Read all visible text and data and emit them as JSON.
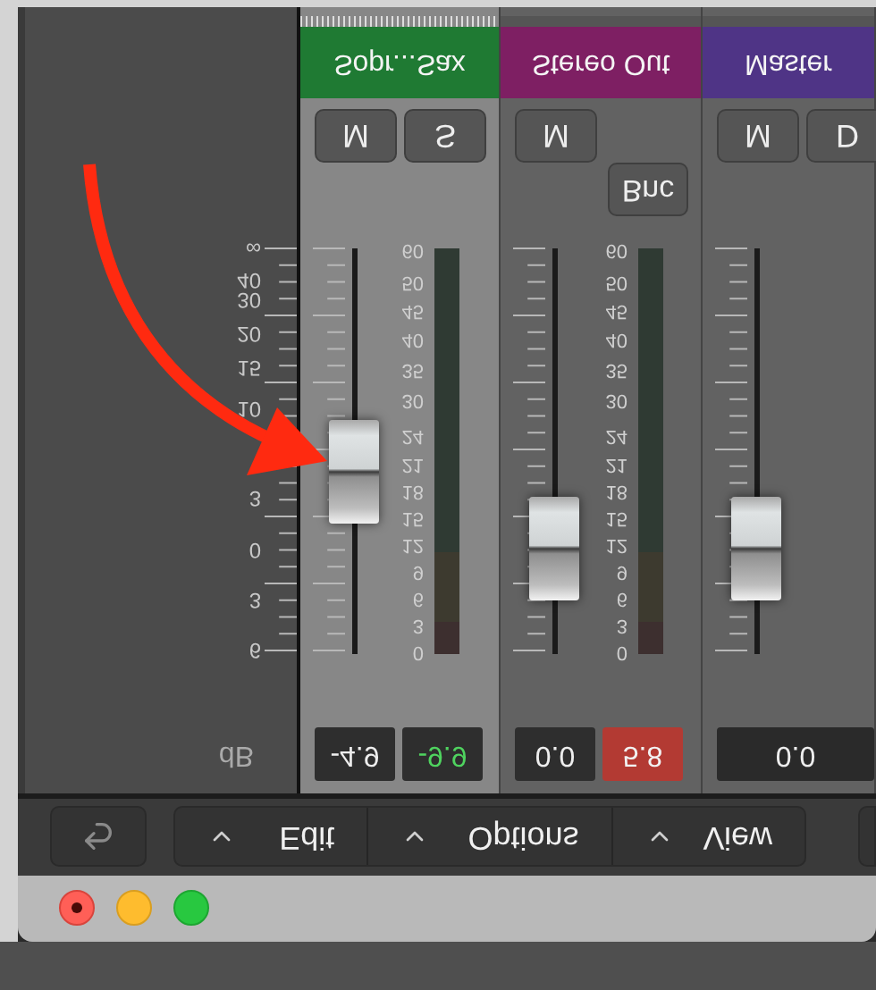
{
  "toolbar": {
    "back_button": {
      "kind": "undo"
    },
    "menus": [
      {
        "label": "Edit"
      },
      {
        "label": "Options"
      },
      {
        "label": "View"
      }
    ]
  },
  "scale": {
    "unit": "dB",
    "labels": [
      "∞",
      "40",
      "30",
      "20",
      "15",
      "10",
      "3",
      "0",
      "3",
      "6"
    ]
  },
  "channels": [
    {
      "name": "Sopr...Sax",
      "color": "#1f7a33",
      "selected": true,
      "buttons": [
        {
          "label": "M"
        },
        {
          "label": "S"
        }
      ],
      "fader": {
        "level": 0.55
      },
      "meter_scale": [
        "60",
        "50",
        "45",
        "40",
        "35",
        "30",
        "24",
        "21",
        "18",
        "15",
        "12",
        "9",
        "6",
        "3",
        "0"
      ],
      "readouts": [
        {
          "value": "-4.9",
          "kind": "volume"
        },
        {
          "value": "-9.9",
          "kind": "peak"
        }
      ]
    },
    {
      "name": "Stereo Out",
      "color": "#7e1f63",
      "selected": false,
      "buttons": [
        {
          "label": "M"
        }
      ],
      "bounce": {
        "label": "Bnc"
      },
      "fader": {
        "level": 0.74
      },
      "meter_scale": [
        "60",
        "50",
        "45",
        "40",
        "35",
        "30",
        "24",
        "21",
        "18",
        "15",
        "12",
        "9",
        "6",
        "3",
        "0"
      ],
      "readouts": [
        {
          "value": "0.0",
          "kind": "volume"
        },
        {
          "value": "5.8",
          "kind": "clip"
        }
      ]
    },
    {
      "name": "Master",
      "color": "#4f3486",
      "selected": false,
      "buttons": [
        {
          "label": "M"
        },
        {
          "label": "D"
        }
      ],
      "fader": {
        "level": 0.74
      },
      "readouts": [
        {
          "value": "0.0",
          "kind": "wide"
        }
      ]
    }
  ]
}
